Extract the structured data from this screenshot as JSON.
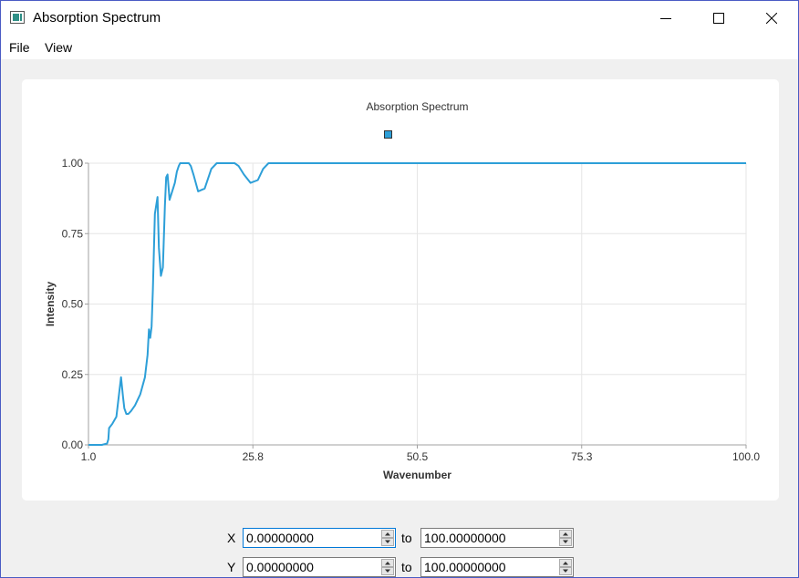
{
  "window": {
    "title": "Absorption Spectrum"
  },
  "menu": {
    "file": "File",
    "view": "View"
  },
  "controls": {
    "x_label": "X",
    "y_label": "Y",
    "to_label": "to",
    "x_min": "0.00000000",
    "x_max": "100.00000000",
    "y_min": "0.00000000",
    "y_max": "100.00000000"
  },
  "chart_data": {
    "type": "line",
    "title": "Absorption Spectrum",
    "xlabel": "Wavenumber",
    "ylabel": "Intensity",
    "xlim": [
      1.0,
      100.0
    ],
    "ylim": [
      0.0,
      1.0
    ],
    "x_ticks": [
      "1.0",
      "25.8",
      "50.5",
      "75.3",
      "100.0"
    ],
    "y_ticks": [
      "0.00",
      "0.25",
      "0.50",
      "0.75",
      "1.00"
    ],
    "grid": true,
    "legend": "top-center",
    "series": [
      {
        "color": "#2d9fd8",
        "x": [
          1.0,
          3.0,
          3.8,
          4.0,
          4.1,
          4.6,
          5.2,
          5.6,
          5.9,
          6.2,
          6.4,
          6.7,
          7.0,
          7.4,
          8.0,
          8.8,
          9.5,
          9.9,
          10.1,
          10.3,
          10.5,
          10.7,
          11.0,
          11.4,
          11.6,
          11.9,
          12.2,
          12.5,
          12.7,
          12.9,
          13.2,
          13.6,
          14.0,
          14.3,
          14.6,
          14.8,
          15.0,
          15.3,
          15.6,
          15.9,
          16.1,
          16.4,
          16.8,
          17.5,
          18.5,
          19.5,
          20.3,
          20.9,
          21.5,
          22.0,
          22.5,
          23.0,
          23.6,
          24.4,
          25.4,
          26.5,
          27.3,
          28.1,
          28.8,
          29.4,
          30.0,
          30.6,
          31.3,
          32.3,
          34.0,
          40.0,
          60.0,
          80.0,
          100.0
        ],
        "values": [
          0.0,
          0.0,
          0.005,
          0.02,
          0.06,
          0.075,
          0.1,
          0.18,
          0.24,
          0.17,
          0.13,
          0.11,
          0.11,
          0.12,
          0.14,
          0.18,
          0.24,
          0.32,
          0.41,
          0.38,
          0.42,
          0.55,
          0.82,
          0.88,
          0.7,
          0.6,
          0.63,
          0.85,
          0.95,
          0.96,
          0.87,
          0.9,
          0.93,
          0.97,
          0.99,
          1.0,
          1.0,
          1.0,
          1.0,
          1.0,
          1.0,
          0.99,
          0.96,
          0.9,
          0.91,
          0.98,
          1.0,
          1.0,
          1.0,
          1.0,
          1.0,
          1.0,
          0.99,
          0.96,
          0.93,
          0.94,
          0.98,
          1.0,
          1.0,
          1.0,
          1.0,
          1.0,
          1.0,
          1.0,
          1.0,
          1.0,
          1.0,
          1.0,
          1.0
        ]
      }
    ]
  }
}
